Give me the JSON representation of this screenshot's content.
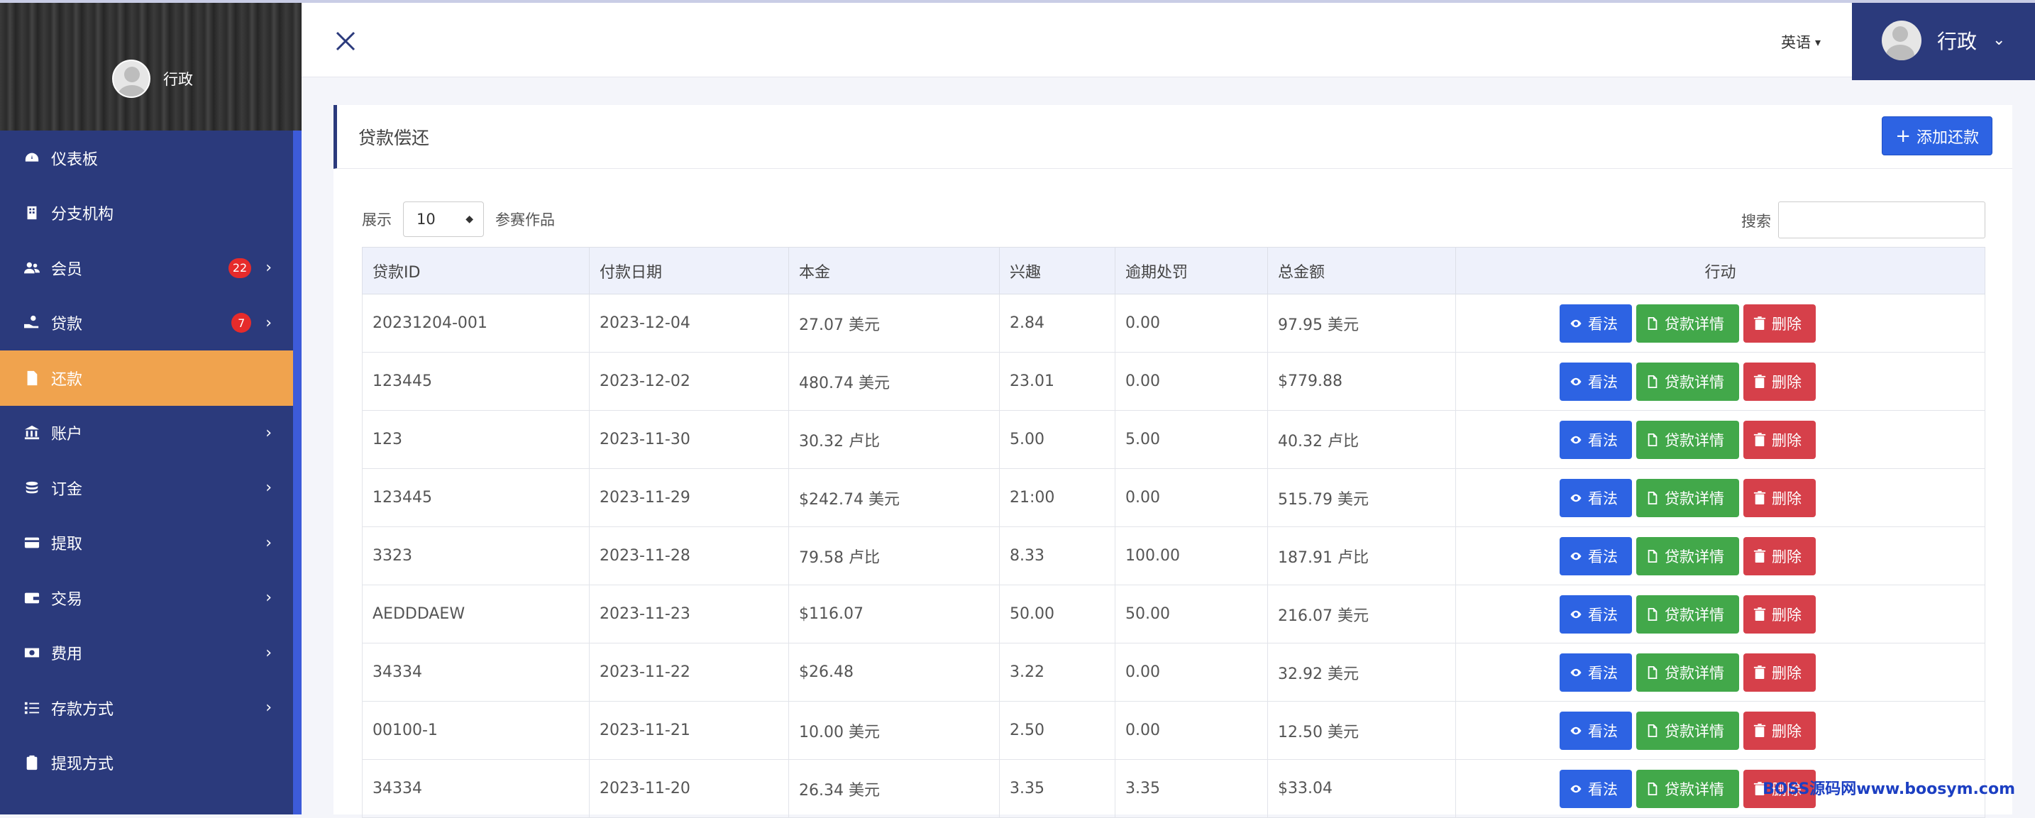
{
  "sidebar": {
    "profile_name": "行政",
    "items": [
      {
        "label": "仪表板",
        "icon": "dashboard-icon",
        "badge": "",
        "chevron": ""
      },
      {
        "label": "分支机构",
        "icon": "building-icon",
        "badge": "",
        "chevron": ""
      },
      {
        "label": "会员",
        "icon": "users-icon",
        "badge": "22",
        "chevron": "›"
      },
      {
        "label": "贷款",
        "icon": "hand-money-icon",
        "badge": "7",
        "chevron": "›"
      },
      {
        "label": "还款",
        "icon": "file-icon",
        "badge": "",
        "chevron": ""
      },
      {
        "label": "账户",
        "icon": "bank-icon",
        "badge": "",
        "chevron": "›"
      },
      {
        "label": "订金",
        "icon": "coins-icon",
        "badge": "",
        "chevron": "›"
      },
      {
        "label": "提取",
        "icon": "card-icon",
        "badge": "",
        "chevron": "›"
      },
      {
        "label": "交易",
        "icon": "wallet-icon",
        "badge": "",
        "chevron": "›"
      },
      {
        "label": "费用",
        "icon": "cash-icon",
        "badge": "",
        "chevron": "›"
      },
      {
        "label": "存款方式",
        "icon": "list-icon",
        "badge": "",
        "chevron": "›"
      },
      {
        "label": "提现方式",
        "icon": "clipboard-icon",
        "badge": "",
        "chevron": ""
      }
    ]
  },
  "header": {
    "language": "英语",
    "user_name": "行政"
  },
  "panel": {
    "title": "贷款偿还",
    "add_label": "添加还款",
    "show_label": "展示",
    "page_size": "10",
    "entries_label": "参赛作品",
    "search_label": "搜索",
    "search_value": ""
  },
  "table": {
    "columns": [
      "贷款ID",
      "付款日期",
      "本金",
      "兴趣",
      "逾期处罚",
      "总金额",
      "行动"
    ],
    "rows": [
      [
        "20231204-001",
        "2023-12-04",
        "27.07 美元",
        "2.84",
        "0.00",
        "97.95 美元"
      ],
      [
        "123445",
        "2023-12-02",
        "480.74 美元",
        "23.01",
        "0.00",
        "$779.88"
      ],
      [
        "123",
        "2023-11-30",
        "30.32 卢比",
        "5.00",
        "5.00",
        "40.32 卢比"
      ],
      [
        "123445",
        "2023-11-29",
        "$242.74 美元",
        "21:00",
        "0.00",
        "515.79 美元"
      ],
      [
        "3323",
        "2023-11-28",
        "79.58 卢比",
        "8.33",
        "100.00",
        "187.91 卢比"
      ],
      [
        "AEDDDAEW",
        "2023-11-23",
        "$116.07",
        "50.00",
        "50.00",
        "216.07 美元"
      ],
      [
        "34334",
        "2023-11-22",
        "$26.48",
        "3.22",
        "0.00",
        "32.92 美元"
      ],
      [
        "00100-1",
        "2023-11-21",
        "10.00 美元",
        "2.50",
        "0.00",
        "12.50 美元"
      ],
      [
        "34334",
        "2023-11-20",
        "26.34 美元",
        "3.35",
        "3.35",
        "$33.04"
      ]
    ],
    "actions": {
      "view": "看法",
      "detail": "贷款详情",
      "delete": "删除"
    }
  },
  "watermark": "BOSS源码网www.boosym.com",
  "colors": {
    "sidebar": "#2b3a7c",
    "active": "#f0a34e",
    "primary": "#2d63e3",
    "success": "#42a84a",
    "danger": "#d6404a"
  }
}
